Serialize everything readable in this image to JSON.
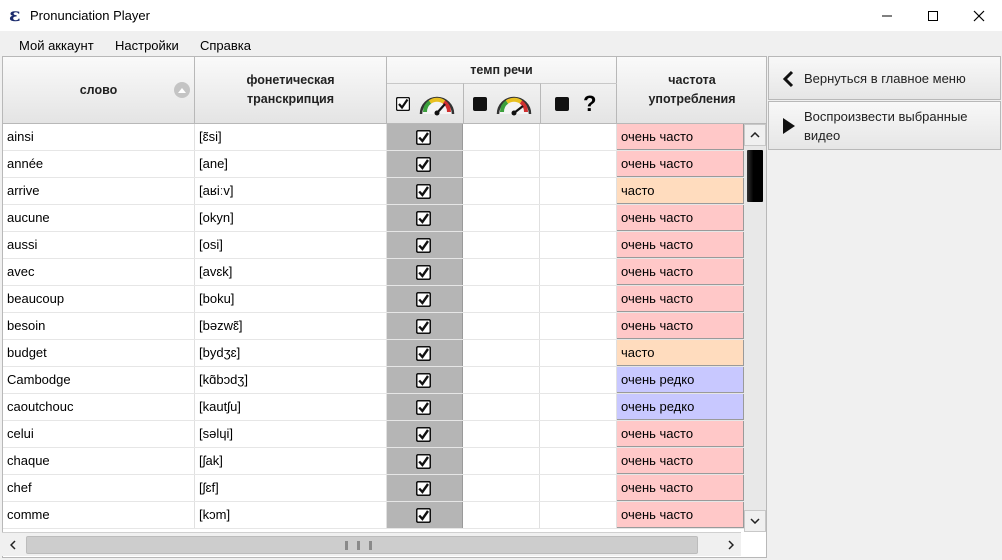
{
  "app": {
    "logo": "ɛ",
    "title": "Pronunciation Player"
  },
  "menu": [
    "Мой аккаунт",
    "Настройки",
    "Справка"
  ],
  "table": {
    "headers": {
      "word": "слово",
      "transcription": "фонетическая транскрипция",
      "speed": "темп речи",
      "frequency": "частота употребления"
    },
    "speed_columns": [
      {
        "icon": "speedometer-icon",
        "checked": true
      },
      {
        "icon": "speedometer-icon",
        "checked": false
      },
      {
        "icon": "question-mark-icon",
        "checked": false
      }
    ],
    "rows": [
      {
        "word": "ainsi",
        "transcription": "[ɛ̃si]",
        "frequency": "очень часто",
        "level": "very-often"
      },
      {
        "word": "année",
        "transcription": "[ane]",
        "frequency": "очень часто",
        "level": "very-often"
      },
      {
        "word": "arrive",
        "transcription": "[aʁiːv]",
        "frequency": "часто",
        "level": "often"
      },
      {
        "word": "aucune",
        "transcription": "[okyn]",
        "frequency": "очень часто",
        "level": "very-often"
      },
      {
        "word": "aussi",
        "transcription": "[osi]",
        "frequency": "очень часто",
        "level": "very-often"
      },
      {
        "word": "avec",
        "transcription": "[avɛk]",
        "frequency": "очень часто",
        "level": "very-often"
      },
      {
        "word": "beaucoup",
        "transcription": "[boku]",
        "frequency": "очень часто",
        "level": "very-often"
      },
      {
        "word": "besoin",
        "transcription": "[bəzwɛ̃]",
        "frequency": "очень часто",
        "level": "very-often"
      },
      {
        "word": "budget",
        "transcription": "[bydʒɛ]",
        "frequency": "часто",
        "level": "often"
      },
      {
        "word": "Cambodge",
        "transcription": "[kɑ̃bɔdʒ]",
        "frequency": "очень редко",
        "level": "very-rare"
      },
      {
        "word": "caoutchouc",
        "transcription": "[kautʃu]",
        "frequency": "очень редко",
        "level": "very-rare"
      },
      {
        "word": "celui",
        "transcription": "[səlɥi]",
        "frequency": "очень часто",
        "level": "very-often"
      },
      {
        "word": "chaque",
        "transcription": "[ʃak]",
        "frequency": "очень часто",
        "level": "very-often"
      },
      {
        "word": "chef",
        "transcription": "[ʃɛf]",
        "frequency": "очень часто",
        "level": "very-often"
      },
      {
        "word": "comme",
        "transcription": "[kɔm]",
        "frequency": "очень часто",
        "level": "very-often"
      }
    ]
  },
  "frequency_colors": {
    "very-often": "#ffc8c8",
    "often": "#ffdcbe",
    "very-rare": "#c8c8ff"
  },
  "side_panel": {
    "back_button": "Вернуться в главное меню",
    "play_button": "Воспроизвести выбранные видео"
  }
}
